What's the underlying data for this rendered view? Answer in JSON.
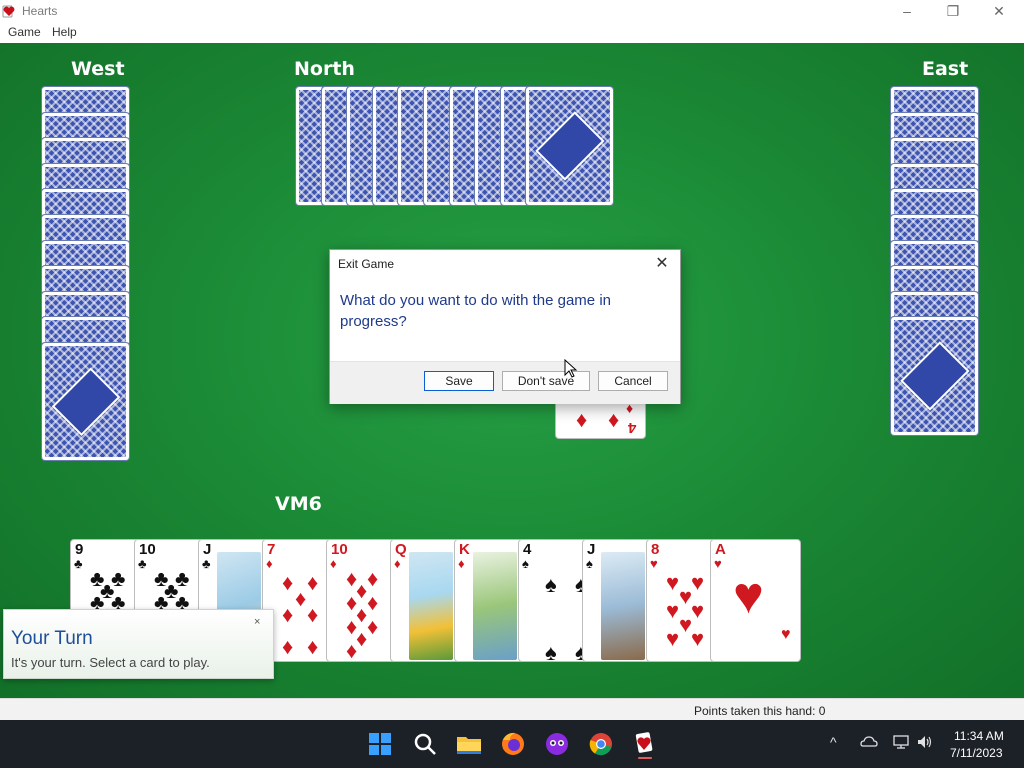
{
  "window": {
    "title": "Hearts",
    "minimize_glyph": "–",
    "maximize_glyph": "❐",
    "close_glyph": "✕"
  },
  "menu": {
    "game": "Game",
    "help": "Help"
  },
  "players": {
    "west": "West",
    "north": "North",
    "east": "East",
    "south": "VM6"
  },
  "dialog": {
    "title": "Exit Game",
    "close_glyph": "✕",
    "message": "What do you want to do with the game in progress?",
    "buttons": {
      "save": "Save",
      "dont_save": "Don't save",
      "cancel": "Cancel"
    }
  },
  "played_card": {
    "rank": "4",
    "suit": "♦"
  },
  "hand": [
    {
      "rank": "9",
      "suit": "♣",
      "color": "black"
    },
    {
      "rank": "10",
      "suit": "♣",
      "color": "black"
    },
    {
      "rank": "J",
      "suit": "♣",
      "color": "black",
      "face": true
    },
    {
      "rank": "7",
      "suit": "♦",
      "color": "red"
    },
    {
      "rank": "10",
      "suit": "♦",
      "color": "red"
    },
    {
      "rank": "Q",
      "suit": "♦",
      "color": "red",
      "face": true
    },
    {
      "rank": "K",
      "suit": "♦",
      "color": "red",
      "face": true
    },
    {
      "rank": "4",
      "suit": "♠",
      "color": "black"
    },
    {
      "rank": "J",
      "suit": "♠",
      "color": "black",
      "face": true
    },
    {
      "rank": "8",
      "suit": "♥",
      "color": "red"
    },
    {
      "rank": "A",
      "suit": "♥",
      "color": "red"
    }
  ],
  "toast": {
    "title": "Your Turn",
    "message": "It's your turn. Select a card to play.",
    "close_glyph": "×"
  },
  "status": {
    "points_text": "Points taken this hand: 0"
  },
  "taskbar": {
    "icons": [
      "windows-start-icon",
      "search-icon",
      "file-explorer-icon",
      "firefox-icon",
      "game-app-icon",
      "chrome-icon",
      "hearts-icon"
    ],
    "tray_chevron": "^",
    "time": "11:34 AM",
    "date": "7/11/2023"
  },
  "colors": {
    "felt": "#1b8a36",
    "card_back": "#3d55b0",
    "dialog_text": "#1f3a8a",
    "red_suit": "#d01820"
  }
}
